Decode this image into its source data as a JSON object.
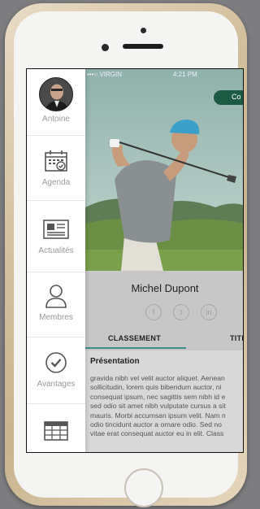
{
  "status_bar": {
    "carrier": "•••○ VIRGIN",
    "time": "4:21 PM"
  },
  "sidebar": {
    "items": [
      {
        "label": "Antoine",
        "icon": "avatar-photo"
      },
      {
        "label": "Agenda",
        "icon": "calendar-icon"
      },
      {
        "label": "Actualités",
        "icon": "newspaper-icon"
      },
      {
        "label": "Membres",
        "icon": "person-icon"
      },
      {
        "label": "Avantages",
        "icon": "checkmark-circle-icon"
      },
      {
        "label": "",
        "icon": "table-grid-icon"
      }
    ]
  },
  "hero": {
    "badge_label": "Co",
    "image": "golfer swinging club on course"
  },
  "profile": {
    "name": "Michel Dupont",
    "social": [
      "f",
      "t",
      "in"
    ]
  },
  "tabs": {
    "active": "CLASSEMENT",
    "other": "TITI"
  },
  "presentation": {
    "heading": "Présentation",
    "lines": [
      "gravida nibh vel velit auctor aliquet. Aenean",
      "sollicitudin, lorem quis bibendum auctor, ni",
      "consequat ipsum, nec sagittis sem nibh id e",
      "sed odio sit amet nibh vulputate cursus a sit",
      "mauris. Morbi accumsan ipsum velit. Nam n",
      "odio tincidunt auctor a ornare odio. Sed no",
      "vitae erat consequat auctor eu in elit. Class"
    ]
  },
  "colors": {
    "accent": "#3e8f86",
    "badge": "#1b5b44",
    "sidebar_label": "#9a9a9a"
  }
}
